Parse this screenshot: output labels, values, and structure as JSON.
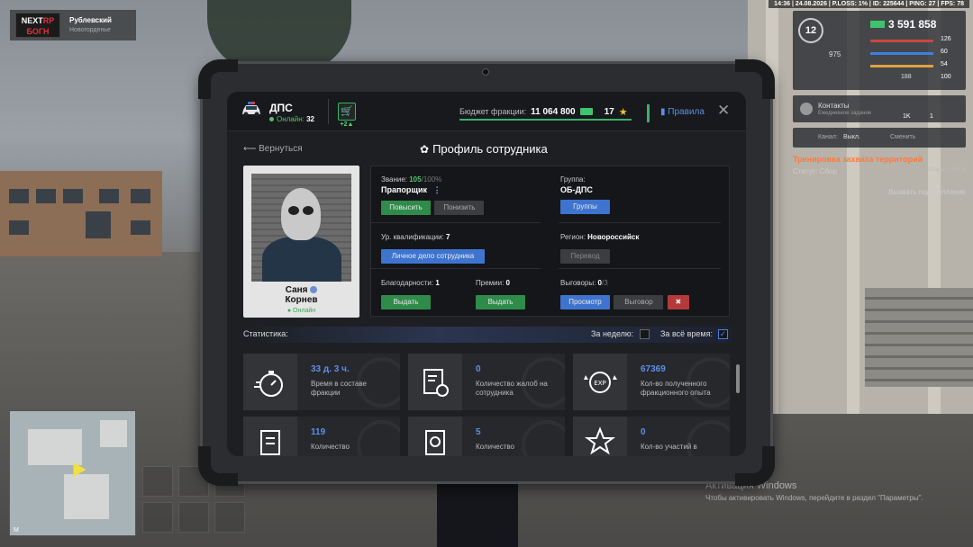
{
  "hud": {
    "top_stats": "14:36 | 24.08.2026 | P.LOSS: 1% | ID: 225644 | PING: 27 | FPS: 78",
    "server_logo_top": "NEXT",
    "server_logo_accent": "RP",
    "server_logo_bottom": "БОГН",
    "server_name": "Рублевский",
    "server_sub": "Новогорденье",
    "level": "12",
    "money": "3 591 858",
    "stats": [
      "126",
      "60",
      "54",
      "100"
    ],
    "small_val": "975",
    "small_val2": "188",
    "contacts_title": "Контакты",
    "contacts_sub": "Ежедневное задание",
    "contacts_c1": "1K",
    "contacts_c2": "1",
    "radio_left": "Канал:",
    "radio_mid": "Выкл.",
    "radio_right": "Сменить",
    "quest_title": "Тренировка захвата территорий",
    "quest_status_label": "Статус:",
    "quest_status_value": "Сбор",
    "quest_open": "Открыть хобби",
    "call_backup": "Вызвать подкрепление",
    "minimap_compass": "М",
    "activation_title": "Активация Windows",
    "activation_sub": "Чтобы активировать Windows, перейдите в раздел \"Параметры\"."
  },
  "header": {
    "faction": "ДПС",
    "online_label": "Онлайн:",
    "online_count": "32",
    "shop_badge": "+2▲",
    "budget_label": "Бюджет фракции:",
    "budget_value": "11 064 800",
    "stars": "17",
    "rules": "Правила"
  },
  "nav": {
    "back": "Вернуться",
    "title": "Профиль сотрудника"
  },
  "employee": {
    "first_name": "Саня",
    "last_name": "Корнев",
    "status": "Онлайн"
  },
  "profile": {
    "rank_label": "Звание:",
    "rank_progress": "105",
    "rank_max": "/100%",
    "rank_name": "Прапорщик",
    "promote": "Повысить",
    "demote": "Понизить",
    "group_label": "Группа:",
    "group_value": "ОБ-ДПС",
    "groups_btn": "Группы",
    "qual_label": "Ур. квалификации:",
    "qual_value": "7",
    "personal_file_btn": "Личное дело сотрудника",
    "region_label": "Регион:",
    "region_value": "Новороссийск",
    "transfer_btn": "Перевод",
    "thanks_label": "Благодарности:",
    "thanks_value": "1",
    "thanks_btn": "Выдать",
    "bonus_label": "Премии:",
    "bonus_value": "0",
    "bonus_btn": "Выдать",
    "reprimand_label": "Выговоры:",
    "reprimand_value": "0",
    "reprimand_max": "/3",
    "view_btn": "Просмотр",
    "reprimand_btn": "Выговор"
  },
  "stats": {
    "title": "Статистика:",
    "week_label": "За неделю:",
    "all_label": "За всё время:",
    "cards": [
      {
        "value": "33 д. 3 ч.",
        "label": "Время в составе фракции",
        "icon": "stopwatch-icon"
      },
      {
        "value": "0",
        "label": "Количество жалоб на сотрудника",
        "icon": "complaint-icon"
      },
      {
        "value": "67369",
        "label": "Кол-во полученного фракционного опыта",
        "icon": "exp-icon"
      },
      {
        "value": "119",
        "label": "Количество",
        "icon": "checklist-icon"
      },
      {
        "value": "5",
        "label": "Количество",
        "icon": "document-coin-icon"
      },
      {
        "value": "0",
        "label": "Кол-во участий в",
        "icon": "star-rank-icon"
      }
    ]
  },
  "colors": {
    "accent_green": "#2f8b4a",
    "accent_blue": "#3e74d0",
    "value_blue": "#5d8fe6",
    "danger_red": "#b33a3a"
  }
}
